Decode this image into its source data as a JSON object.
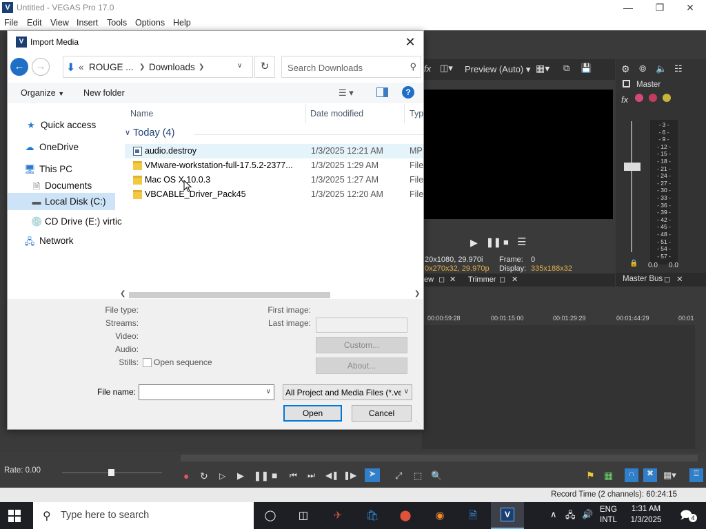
{
  "app": {
    "title": "Untitled - VEGAS Pro 17.0",
    "icon_letter": "V",
    "menu": [
      "File",
      "Edit",
      "View",
      "Insert",
      "Tools",
      "Options",
      "Help"
    ],
    "preview_label": "Preview (Auto)",
    "master_label": "Master",
    "preview_info": {
      "line1_left": "20x1080, 29.970i",
      "line2_left": "0x270x32, 29.970p",
      "frame_label": "Frame:",
      "frame_value": "0",
      "display_label": "Display:",
      "display_value": "335x188x32"
    },
    "tabs": {
      "view_tab": "ew",
      "trimmer": "Trimmer",
      "master_bus": "Master Bus"
    },
    "meter_ticks": [
      "3",
      "6",
      "9",
      "12",
      "15",
      "18",
      "21",
      "24",
      "27",
      "30",
      "33",
      "36",
      "39",
      "42",
      "45",
      "48",
      "51",
      "54",
      "57"
    ],
    "meter_values": [
      "0.0",
      "0.0"
    ],
    "timeline_marks": [
      "00:00:59:28",
      "00:01:15:00",
      "00:01:29:29",
      "00:01:44:29",
      "00:01"
    ],
    "rate": "Rate: 0.00",
    "status": "Record Time (2 channels): 60:24:15"
  },
  "dialog": {
    "title": "Import Media",
    "address": {
      "root": "ROUGE ...",
      "folder": "Downloads"
    },
    "search_placeholder": "Search Downloads",
    "organize": "Organize",
    "new_folder": "New folder",
    "help": "?",
    "nav": {
      "quick_access": "Quick access",
      "onedrive": "OneDrive",
      "this_pc": "This PC",
      "documents": "Documents",
      "local_disk": "Local Disk (C:)",
      "cd_drive": "CD Drive (E:) virtic",
      "network": "Network"
    },
    "columns": {
      "name": "Name",
      "date": "Date modified",
      "type": "Typ"
    },
    "group": "Today (4)",
    "files": [
      {
        "name": "audio.destroy",
        "date": "1/3/2025 12:21 AM",
        "type": "MP",
        "kind": "doc"
      },
      {
        "name": "VMware-workstation-full-17.5.2-2377...",
        "date": "1/3/2025 1:29 AM",
        "type": "File",
        "kind": "folder"
      },
      {
        "name": "Mac OS X 10.0.3",
        "date": "1/3/2025 1:27 AM",
        "type": "File",
        "kind": "folder"
      },
      {
        "name": "VBCABLE_Driver_Pack45",
        "date": "1/3/2025 12:20 AM",
        "type": "File",
        "kind": "folder"
      }
    ],
    "info": {
      "file_type": "File type:",
      "streams": "Streams:",
      "video": "Video:",
      "audio": "Audio:",
      "stills": "Stills:",
      "open_sequence": "Open sequence",
      "first_image": "First image:",
      "last_image": "Last image:",
      "custom": "Custom...",
      "about": "About..."
    },
    "file_name_label": "File name:",
    "file_name_value": "",
    "filter": "All Project and Media Files (*.ve",
    "open": "Open",
    "cancel": "Cancel"
  },
  "taskbar": {
    "search_placeholder": "Type here to search",
    "lang1": "ENG",
    "lang2": "INTL",
    "time": "1:31 AM",
    "date": "1/3/2025",
    "notifications": "4"
  },
  "colors": {
    "accent": "#0078d7",
    "selected": "#cde3f7",
    "hover": "#e5f3fb",
    "vegas_dark": "#3a3a3a"
  }
}
